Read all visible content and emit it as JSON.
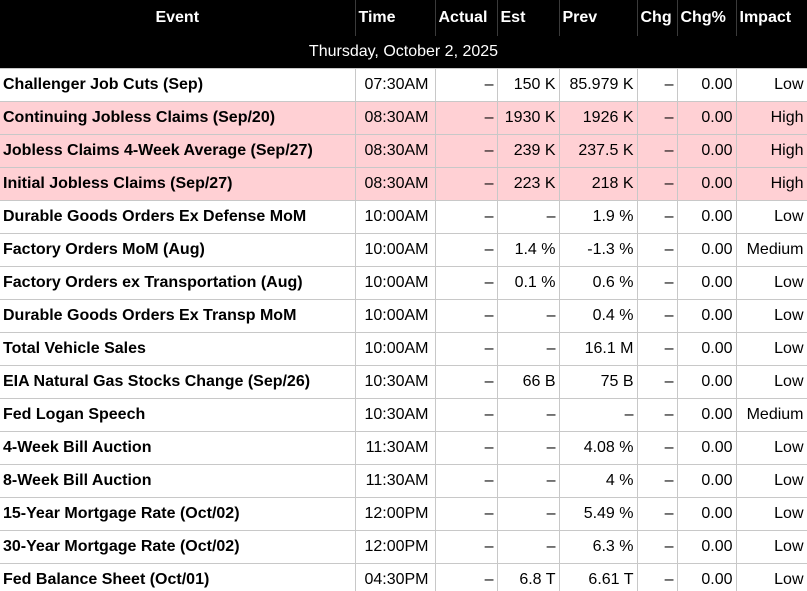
{
  "columns": {
    "event": "Event",
    "time": "Time",
    "actual": "Actual",
    "est": "Est",
    "prev": "Prev",
    "chg": "Chg",
    "chg_pct": "Chg%",
    "impact": "Impact"
  },
  "date_label": "Thursday, October 2, 2025",
  "highlight_color": "#ffd0d4",
  "rows": [
    {
      "event": "Challenger Job Cuts (Sep)",
      "time": "07:30AM",
      "actual": "–",
      "est": "150 K",
      "prev": "85.979 K",
      "chg": "–",
      "chg_pct": "0.00",
      "impact": "Low"
    },
    {
      "event": "Continuing Jobless Claims (Sep/20)",
      "time": "08:30AM",
      "actual": "–",
      "est": "1930 K",
      "prev": "1926 K",
      "chg": "–",
      "chg_pct": "0.00",
      "impact": "High"
    },
    {
      "event": "Jobless Claims 4-Week Average (Sep/27)",
      "time": "08:30AM",
      "actual": "–",
      "est": "239 K",
      "prev": "237.5 K",
      "chg": "–",
      "chg_pct": "0.00",
      "impact": "High"
    },
    {
      "event": "Initial Jobless Claims (Sep/27)",
      "time": "08:30AM",
      "actual": "–",
      "est": "223 K",
      "prev": "218 K",
      "chg": "–",
      "chg_pct": "0.00",
      "impact": "High"
    },
    {
      "event": "Durable Goods Orders Ex Defense MoM",
      "time": "10:00AM",
      "actual": "–",
      "est": "–",
      "prev": "1.9 %",
      "chg": "–",
      "chg_pct": "0.00",
      "impact": "Low"
    },
    {
      "event": "Factory Orders MoM (Aug)",
      "time": "10:00AM",
      "actual": "–",
      "est": "1.4 %",
      "prev": "-1.3 %",
      "chg": "–",
      "chg_pct": "0.00",
      "impact": "Medium"
    },
    {
      "event": "Factory Orders ex Transportation (Aug)",
      "time": "10:00AM",
      "actual": "–",
      "est": "0.1 %",
      "prev": "0.6 %",
      "chg": "–",
      "chg_pct": "0.00",
      "impact": "Low"
    },
    {
      "event": "Durable Goods Orders Ex Transp MoM",
      "time": "10:00AM",
      "actual": "–",
      "est": "–",
      "prev": "0.4 %",
      "chg": "–",
      "chg_pct": "0.00",
      "impact": "Low"
    },
    {
      "event": "Total Vehicle Sales",
      "time": "10:00AM",
      "actual": "–",
      "est": "–",
      "prev": "16.1 M",
      "chg": "–",
      "chg_pct": "0.00",
      "impact": "Low"
    },
    {
      "event": "EIA Natural Gas Stocks Change (Sep/26)",
      "time": "10:30AM",
      "actual": "–",
      "est": "66 B",
      "prev": "75 B",
      "chg": "–",
      "chg_pct": "0.00",
      "impact": "Low"
    },
    {
      "event": "Fed Logan Speech",
      "time": "10:30AM",
      "actual": "–",
      "est": "–",
      "prev": "–",
      "chg": "–",
      "chg_pct": "0.00",
      "impact": "Medium"
    },
    {
      "event": "4-Week Bill Auction",
      "time": "11:30AM",
      "actual": "–",
      "est": "–",
      "prev": "4.08 %",
      "chg": "–",
      "chg_pct": "0.00",
      "impact": "Low"
    },
    {
      "event": "8-Week Bill Auction",
      "time": "11:30AM",
      "actual": "–",
      "est": "–",
      "prev": "4 %",
      "chg": "–",
      "chg_pct": "0.00",
      "impact": "Low"
    },
    {
      "event": "15-Year Mortgage Rate (Oct/02)",
      "time": "12:00PM",
      "actual": "–",
      "est": "–",
      "prev": "5.49 %",
      "chg": "–",
      "chg_pct": "0.00",
      "impact": "Low"
    },
    {
      "event": "30-Year Mortgage Rate (Oct/02)",
      "time": "12:00PM",
      "actual": "–",
      "est": "–",
      "prev": "6.3 %",
      "chg": "–",
      "chg_pct": "0.00",
      "impact": "Low"
    },
    {
      "event": "Fed Balance Sheet (Oct/01)",
      "time": "04:30PM",
      "actual": "–",
      "est": "6.8 T",
      "prev": "6.61 T",
      "chg": "–",
      "chg_pct": "0.00",
      "impact": "Low"
    }
  ]
}
